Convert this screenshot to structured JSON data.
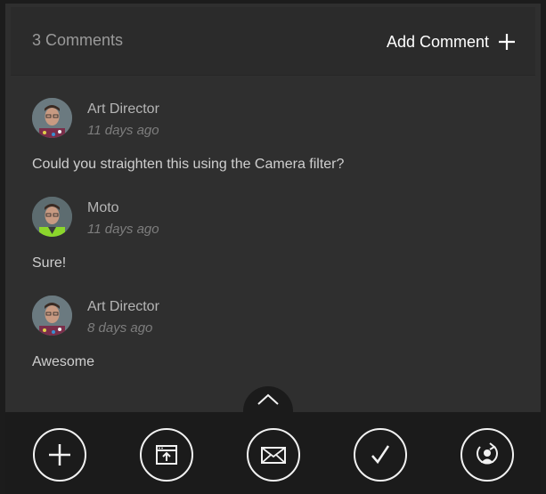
{
  "header": {
    "count_label": "3 Comments",
    "add_label": "Add Comment"
  },
  "comments": [
    {
      "author": "Art Director",
      "time": "11 days ago",
      "text": "Could you straighten this using the Camera filter?",
      "shirt": "#7a2e4a"
    },
    {
      "author": "Moto",
      "time": "11 days ago",
      "text": "Sure!",
      "shirt": "#8bd62c"
    },
    {
      "author": "Art Director",
      "time": "8 days ago",
      "text": "Awesome",
      "shirt": "#7a2e4a"
    }
  ],
  "toolbar": {
    "icons": [
      "add-icon",
      "share-icon",
      "mail-icon",
      "checkmark-icon",
      "user-sync-icon"
    ],
    "expand_icon": "chevron-up-icon"
  }
}
